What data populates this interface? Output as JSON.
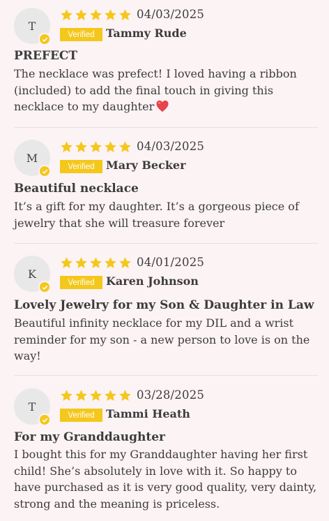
{
  "colors": {
    "background": "#fcf3f5",
    "accent_gold": "#f4c71b",
    "text": "#3c3c3c",
    "avatar_bg": "#e8e8e8"
  },
  "reviews": [
    {
      "initial": "T",
      "rating": 5,
      "date": "04/03/2025",
      "badge": "Verified",
      "name": "Tammy Rude",
      "title": "PREFECT",
      "body": "The necklace was prefect! I loved having a ribbon (included) to add the final touch in giving this necklace to my daughter",
      "emoji": "red-heart-icon"
    },
    {
      "initial": "M",
      "rating": 5,
      "date": "04/03/2025",
      "badge": "Verified",
      "name": "Mary Becker",
      "title": "Beautiful necklace",
      "body": "It’s a gift for my daughter. It’s a gorgeous piece of jewelry that she will treasure forever"
    },
    {
      "initial": "K",
      "rating": 5,
      "date": "04/01/2025",
      "badge": "Verified",
      "name": "Karen Johnson",
      "title": "Lovely Jewelry for my Son & Daughter in Law",
      "body": "Beautiful infinity necklace for my DIL and a wrist reminder for my son - a new person to love is on the way!"
    },
    {
      "initial": "T",
      "rating": 5,
      "date": "03/28/2025",
      "badge": "Verified",
      "name": "Tammi Heath",
      "title": "For my Granddaughter",
      "body": "I bought this for my Granddaughter having her first child! She’s absolutely in love with it. So happy to have purchased as it is very good quality, very dainty, strong and the meaning is priceless."
    }
  ]
}
